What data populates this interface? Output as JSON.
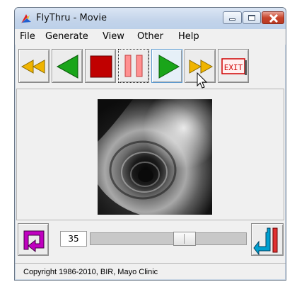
{
  "window": {
    "title": "FlyThru - Movie",
    "controls": [
      "minimize",
      "maximize",
      "close"
    ]
  },
  "menu": {
    "items": [
      "File",
      "Generate",
      "View",
      "Other",
      "Help"
    ]
  },
  "toolbar": {
    "buttons": [
      {
        "name": "rewind",
        "icon": "double-left-arrow-icon",
        "color": "#f0b400"
      },
      {
        "name": "play-backward",
        "icon": "left-triangle-icon",
        "color": "#1aa51a"
      },
      {
        "name": "stop",
        "icon": "stop-square-icon",
        "color": "#c00000"
      },
      {
        "name": "pause",
        "icon": "pause-bars-icon",
        "color": "#ff9090"
      },
      {
        "name": "play-forward",
        "icon": "right-triangle-icon",
        "color": "#1aa51a"
      },
      {
        "name": "fast-forward",
        "icon": "double-right-arrow-icon",
        "color": "#f0b400"
      },
      {
        "name": "exit",
        "icon": "exit-icon",
        "label": "EXIT",
        "color": "#d00000"
      }
    ]
  },
  "viewer": {
    "content": "endoscopic fly-through frame"
  },
  "playback": {
    "frame_number": "35",
    "slider_fraction": 0.62,
    "loop_icon_color": "#c000c0",
    "bounce_icon_color": "#00a0d0"
  },
  "status": {
    "text": "Copyright 1986-2010, BIR, Mayo Clinic"
  }
}
